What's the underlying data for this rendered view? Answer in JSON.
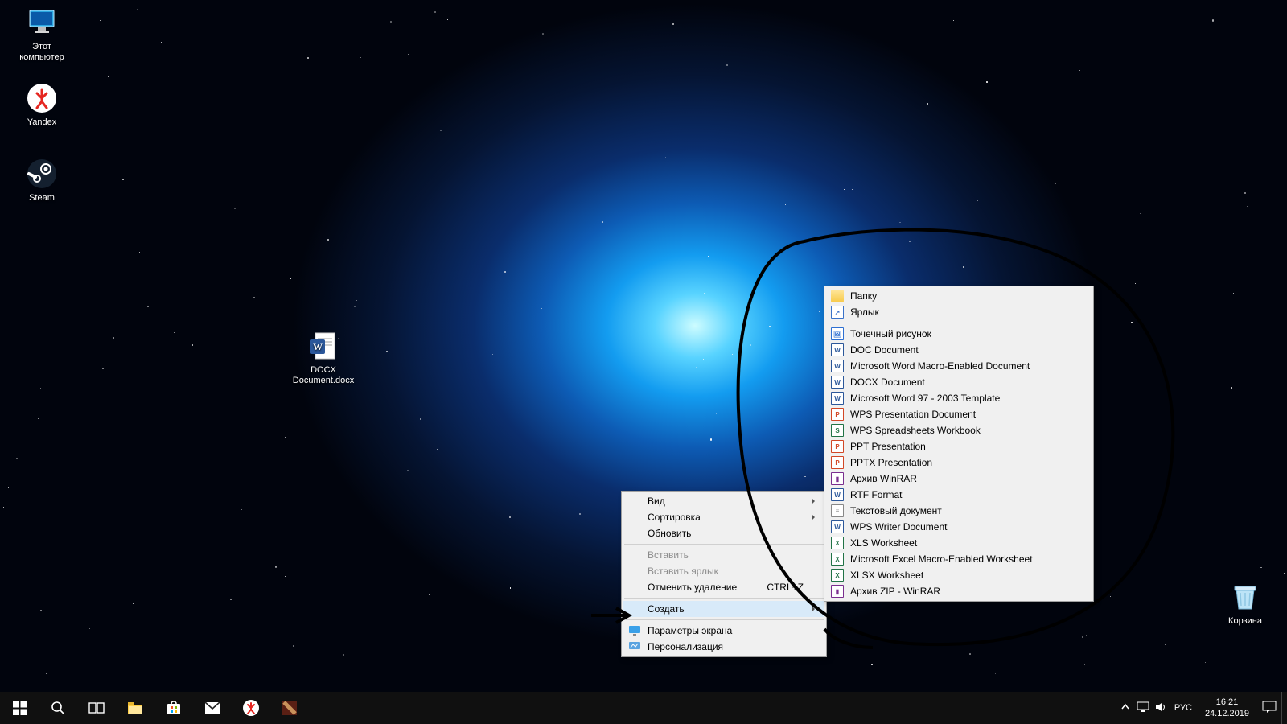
{
  "desktop_icons": {
    "this_pc": "Этот компьютер",
    "yandex": "Yandex",
    "steam": "Steam",
    "docx_file": "DOCX Document.docx",
    "recycle": "Корзина"
  },
  "context_menu": {
    "view": "Вид",
    "sort": "Сортировка",
    "refresh": "Обновить",
    "paste": "Вставить",
    "paste_shortcut": "Вставить ярлык",
    "undo_delete": "Отменить удаление",
    "undo_shortcut": "CTRL+Z",
    "create": "Создать",
    "display_settings": "Параметры экрана",
    "personalize": "Персонализация"
  },
  "create_submenu": [
    {
      "label": "Папку",
      "icon": "folder"
    },
    {
      "label": "Ярлык",
      "icon": "shortcut"
    },
    {
      "sep": true
    },
    {
      "label": "Точечный рисунок",
      "icon": "bmp"
    },
    {
      "label": "DOC Document",
      "icon": "doc"
    },
    {
      "label": "Microsoft Word Macro-Enabled Document",
      "icon": "docm"
    },
    {
      "label": "DOCX Document",
      "icon": "docx"
    },
    {
      "label": "Microsoft Word 97 - 2003 Template",
      "icon": "dot"
    },
    {
      "label": "WPS Presentation Document",
      "icon": "wpp"
    },
    {
      "label": "WPS Spreadsheets Workbook",
      "icon": "wss"
    },
    {
      "label": "PPT Presentation",
      "icon": "ppt"
    },
    {
      "label": "PPTX Presentation",
      "icon": "pptx"
    },
    {
      "label": "Архив WinRAR",
      "icon": "rar"
    },
    {
      "label": "RTF Format",
      "icon": "rtf"
    },
    {
      "label": "Текстовый документ",
      "icon": "txt"
    },
    {
      "label": "WPS Writer Document",
      "icon": "wpw"
    },
    {
      "label": "XLS Worksheet",
      "icon": "xls"
    },
    {
      "label": "Microsoft Excel Macro-Enabled Worksheet",
      "icon": "xlsm"
    },
    {
      "label": "XLSX Worksheet",
      "icon": "xlsx"
    },
    {
      "label": "Архив ZIP - WinRAR",
      "icon": "zip"
    }
  ],
  "taskbar": {
    "lang": "РУС",
    "time": "16:21",
    "date": "24.12.2019"
  },
  "icon_styles": {
    "folder": {
      "bg": "#ffe79c",
      "bd": "#d7a93a",
      "fg": "#7a5b00",
      "t": ""
    },
    "shortcut": {
      "bg": "#fff",
      "bd": "#3a72c9",
      "fg": "#3a72c9",
      "t": "↗"
    },
    "bmp": {
      "bg": "#fff",
      "bd": "#2d6fd2",
      "fg": "#2d6fd2",
      "t": "🖼"
    },
    "doc": {
      "bg": "#fff",
      "bd": "#2b579a",
      "fg": "#2b579a",
      "t": "W"
    },
    "docm": {
      "bg": "#fff",
      "bd": "#2b579a",
      "fg": "#2b579a",
      "t": "W"
    },
    "docx": {
      "bg": "#fff",
      "bd": "#2b579a",
      "fg": "#2b579a",
      "t": "W"
    },
    "dot": {
      "bg": "#fff",
      "bd": "#2b579a",
      "fg": "#2b579a",
      "t": "W"
    },
    "wpp": {
      "bg": "#fff",
      "bd": "#d24726",
      "fg": "#d24726",
      "t": "P"
    },
    "wss": {
      "bg": "#fff",
      "bd": "#217346",
      "fg": "#217346",
      "t": "S"
    },
    "ppt": {
      "bg": "#fff",
      "bd": "#d24726",
      "fg": "#d24726",
      "t": "P"
    },
    "pptx": {
      "bg": "#fff",
      "bd": "#d24726",
      "fg": "#d24726",
      "t": "P"
    },
    "rar": {
      "bg": "#fff",
      "bd": "#7a2e8f",
      "fg": "#7a2e8f",
      "t": "▮"
    },
    "rtf": {
      "bg": "#fff",
      "bd": "#2b579a",
      "fg": "#2b579a",
      "t": "W"
    },
    "txt": {
      "bg": "#fff",
      "bd": "#888",
      "fg": "#888",
      "t": "≡"
    },
    "wpw": {
      "bg": "#fff",
      "bd": "#2b579a",
      "fg": "#2b579a",
      "t": "W"
    },
    "xls": {
      "bg": "#fff",
      "bd": "#217346",
      "fg": "#217346",
      "t": "X"
    },
    "xlsm": {
      "bg": "#fff",
      "bd": "#217346",
      "fg": "#217346",
      "t": "X"
    },
    "xlsx": {
      "bg": "#fff",
      "bd": "#217346",
      "fg": "#217346",
      "t": "X"
    },
    "zip": {
      "bg": "#fff",
      "bd": "#7a2e8f",
      "fg": "#7a2e8f",
      "t": "▮"
    }
  }
}
